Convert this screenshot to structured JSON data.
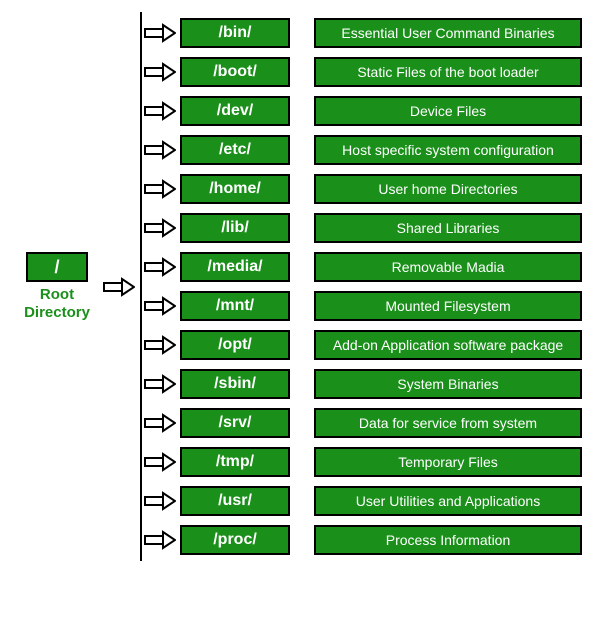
{
  "root": {
    "symbol": "/",
    "label_line1": "Root",
    "label_line2": "Directory"
  },
  "entries": [
    {
      "dir": "/bin/",
      "desc": "Essential User Command Binaries"
    },
    {
      "dir": "/boot/",
      "desc": "Static Files of the boot loader"
    },
    {
      "dir": "/dev/",
      "desc": "Device Files"
    },
    {
      "dir": "/etc/",
      "desc": "Host specific system configuration"
    },
    {
      "dir": "/home/",
      "desc": "User home Directories"
    },
    {
      "dir": "/lib/",
      "desc": "Shared Libraries"
    },
    {
      "dir": "/media/",
      "desc": "Removable Madia"
    },
    {
      "dir": "/mnt/",
      "desc": "Mounted Filesystem"
    },
    {
      "dir": "/opt/",
      "desc": "Add-on Application software package"
    },
    {
      "dir": "/sbin/",
      "desc": "System Binaries"
    },
    {
      "dir": "/srv/",
      "desc": "Data for service from system"
    },
    {
      "dir": "/tmp/",
      "desc": "Temporary Files"
    },
    {
      "dir": "/usr/",
      "desc": "User Utilities and Applications"
    },
    {
      "dir": "/proc/",
      "desc": "Process Information"
    }
  ]
}
